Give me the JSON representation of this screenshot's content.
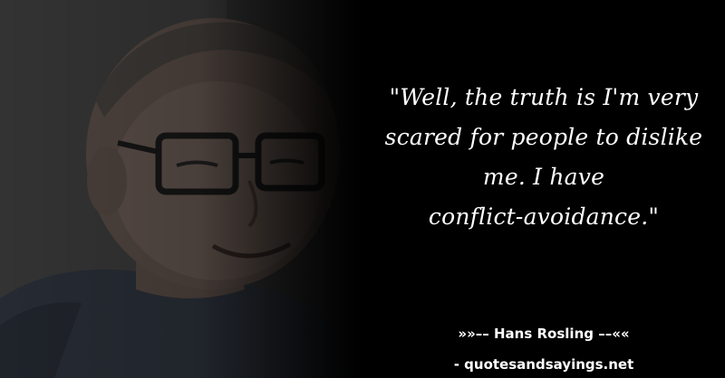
{
  "quote": {
    "lines": [
      "\"Well, the truth is I'm very",
      "scared for people to dislike",
      "me. I have",
      "conflict-avoidance.\""
    ]
  },
  "attribution": {
    "author_line": "»»–– Hans Rosling ––««",
    "source_line": "- quotesandsayings.net"
  },
  "photo": {
    "subject": "portrait-photo"
  }
}
